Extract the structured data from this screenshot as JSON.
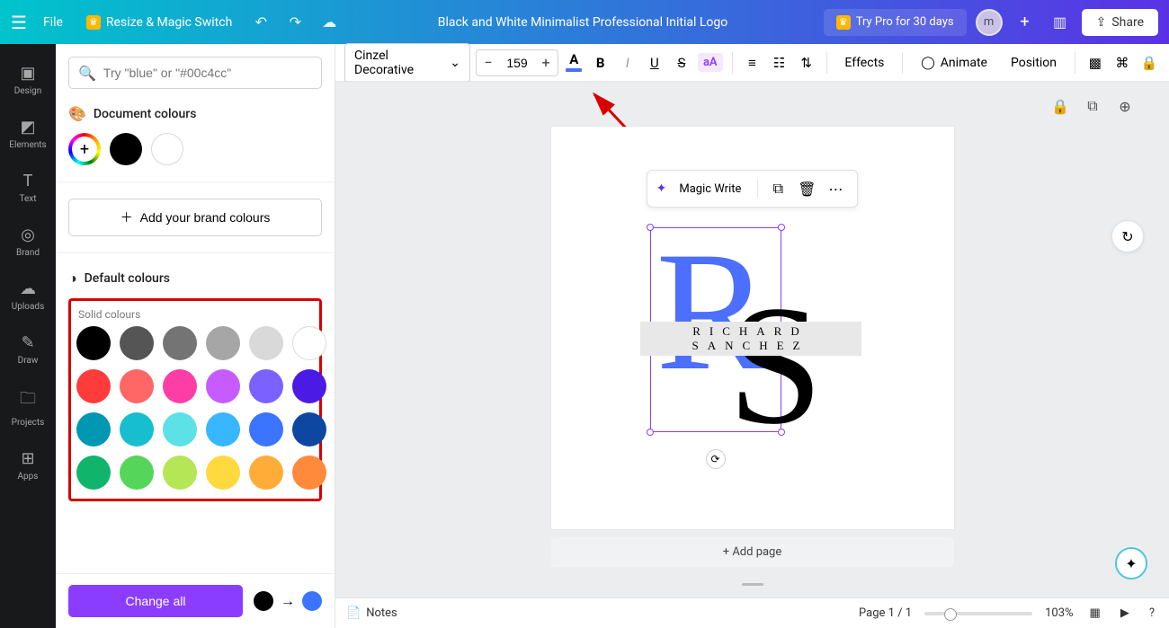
{
  "topbar": {
    "file": "File",
    "resize": "Resize & Magic Switch",
    "title": "Black and White Minimalist Professional Initial Logo",
    "trypro": "Try Pro for 30 days",
    "avatar_letter": "m",
    "share": "Share"
  },
  "leftrail": [
    {
      "label": "Design"
    },
    {
      "label": "Elements"
    },
    {
      "label": "Text"
    },
    {
      "label": "Brand"
    },
    {
      "label": "Uploads"
    },
    {
      "label": "Draw"
    },
    {
      "label": "Projects"
    },
    {
      "label": "Apps"
    }
  ],
  "sidepanel": {
    "search_placeholder": "Try \"blue\" or \"#00c4cc\"",
    "document_colours_label": "Document colours",
    "document_colours": [
      "#000000",
      "#ffffff"
    ],
    "add_brand_label": "Add your brand colours",
    "default_colours_label": "Default colours",
    "solid_label": "Solid colours",
    "solid_colours": [
      "#000000",
      "#555555",
      "#747474",
      "#a6a6a6",
      "#d9d9d9",
      "#ffffff",
      "#ff3b3b",
      "#ff6666",
      "#ff3ea5",
      "#c65cff",
      "#7b61ff",
      "#4b1ae5",
      "#0097b2",
      "#17becf",
      "#5ce1e6",
      "#38b6ff",
      "#3a74ff",
      "#0d47a1",
      "#11b46b",
      "#55d65a",
      "#b5e655",
      "#ffd93d",
      "#ffac38",
      "#ff8a3b"
    ],
    "change_all": "Change all",
    "from_color": "#000000",
    "to_color": "#3a74ff"
  },
  "editorbar": {
    "font_family": "Cinzel Decorative",
    "font_size": "159",
    "effects": "Effects",
    "animate": "Animate",
    "position": "Position"
  },
  "canvas": {
    "magic_write": "Magic Write",
    "big_r": "R",
    "big_s": "S",
    "nameband": "RICHARD SANCHEZ",
    "add_page": "+ Add page"
  },
  "bottombar": {
    "notes": "Notes",
    "page_indicator": "Page 1 / 1",
    "zoom": "103%"
  }
}
